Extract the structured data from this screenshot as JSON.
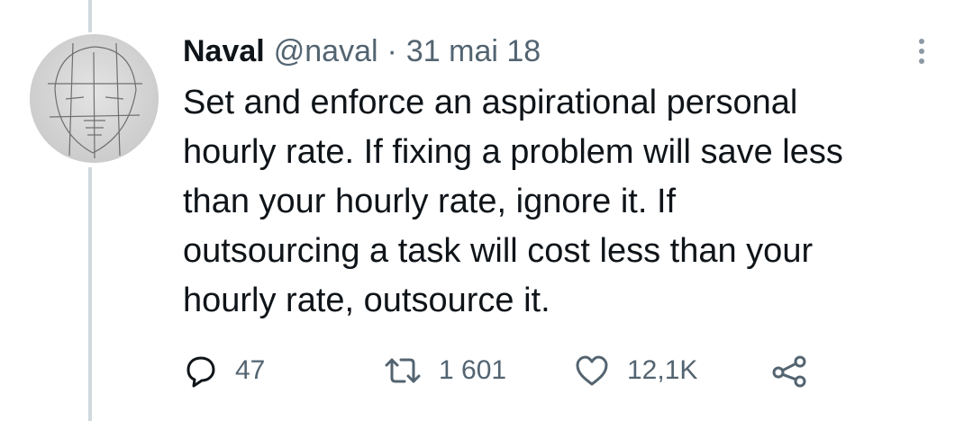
{
  "tweet": {
    "author_name": "Naval",
    "handle": "@naval",
    "separator": "·",
    "date": "31 mai 18",
    "text": "Set and enforce an aspirational personal\nhourly rate. If fixing a problem will save less\nthan your hourly rate, ignore it. If\noutsourcing a task will cost less than your\nhourly rate, outsource it."
  },
  "actions": {
    "reply": {
      "icon": "reply-icon",
      "count": "47"
    },
    "retweet": {
      "icon": "retweet-icon",
      "count": "1 601"
    },
    "like": {
      "icon": "heart-icon",
      "count": "12,1K"
    },
    "share": {
      "icon": "share-icon"
    }
  },
  "more": {
    "icon": "more-options-icon"
  },
  "colors": {
    "text_primary": "#0f1419",
    "text_secondary": "#536471",
    "thread_line": "#cfd9de",
    "background": "#ffffff"
  }
}
